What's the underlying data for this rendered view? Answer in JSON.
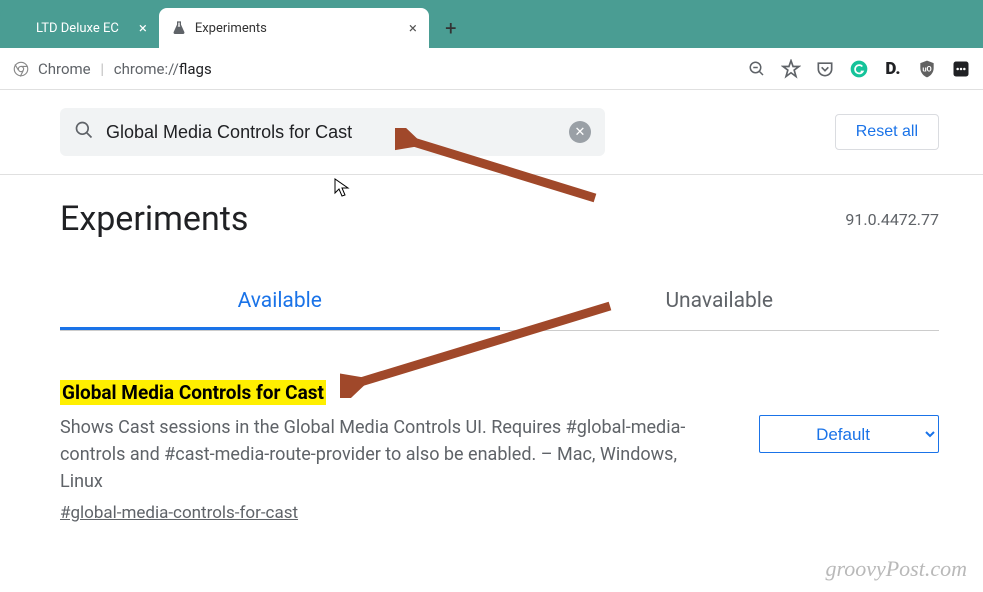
{
  "tabs": [
    {
      "title": "LTD Deluxe EC"
    },
    {
      "title": "Experiments"
    }
  ],
  "address": {
    "scheme": "Chrome",
    "url_prefix": "chrome://",
    "url_path": "flags"
  },
  "search": {
    "value": "Global Media Controls for Cast"
  },
  "reset_label": "Reset all",
  "page_title": "Experiments",
  "version": "91.0.4472.77",
  "content_tabs": {
    "available": "Available",
    "unavailable": "Unavailable"
  },
  "flag": {
    "title": "Global Media Controls for Cast",
    "description": "Shows Cast sessions in the Global Media Controls UI. Requires #global-media-controls and #cast-media-route-provider to also be enabled. – Mac, Windows, Linux",
    "anchor": "#global-media-controls-for-cast",
    "select_value": "Default"
  },
  "watermark": "groovyPost.com"
}
